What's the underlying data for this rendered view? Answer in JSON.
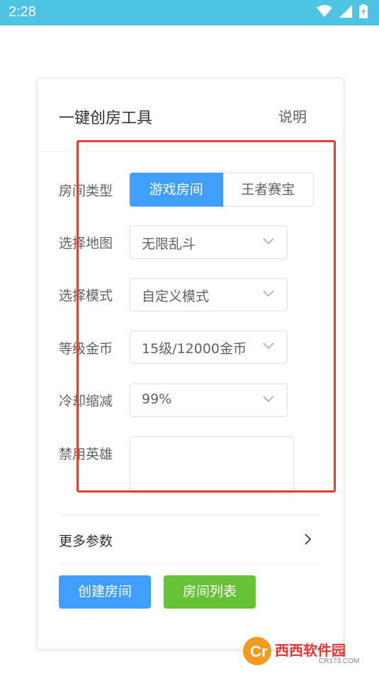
{
  "status_bar": {
    "time": "2:28"
  },
  "card": {
    "title": "一键创房工具",
    "help_label": "说明"
  },
  "form": {
    "room_type": {
      "label": "房间类型",
      "options": [
        "游戏房间",
        "王者赛宝"
      ],
      "selected": "游戏房间"
    },
    "map": {
      "label": "选择地图",
      "value": "无限乱斗"
    },
    "mode": {
      "label": "选择模式",
      "value": "自定义模式"
    },
    "level_gold": {
      "label": "等级金币",
      "value": "15级/12000金币"
    },
    "cooldown": {
      "label": "冷却缩减",
      "value": "99%"
    },
    "banned_heroes": {
      "label": "禁用英雄",
      "value": ""
    }
  },
  "more_params": {
    "label": "更多参数"
  },
  "buttons": {
    "create": "创建房间",
    "list": "房间列表"
  },
  "watermark": {
    "text": "西西软件园",
    "sub": "CR173.COM"
  },
  "colors": {
    "primary": "#409eff",
    "success": "#67c23a",
    "status_bar": "#4ec3e3",
    "highlight": "#d9432f"
  }
}
